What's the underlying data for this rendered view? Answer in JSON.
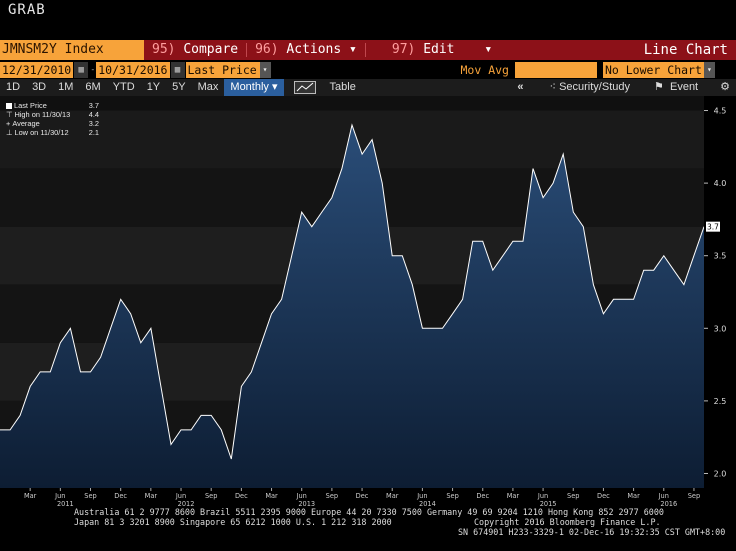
{
  "app_title": "GRAB",
  "toolbar": {
    "ticker": "JMNSM2Y Index",
    "compare_num": "95)",
    "compare_label": "Compare",
    "actions_num": "96)",
    "actions_label": "Actions",
    "edit_num": "97)",
    "edit_label": "Edit",
    "view_title": "Line Chart"
  },
  "date_range": {
    "start": "12/31/2010",
    "end": "10/31/2016",
    "field": "Last Price",
    "study": "Mov Avg",
    "lower_chart": "No Lower Chart"
  },
  "periods": [
    "1D",
    "3D",
    "1M",
    "6M",
    "YTD",
    "1Y",
    "5Y",
    "Max"
  ],
  "frequency": "Monthly",
  "table_label": "Table",
  "security_study_label": "Security/Study",
  "event_label": "Event",
  "legend": {
    "last_label": "Last Price",
    "last_value": "3.7",
    "high_label": "High on 11/30/13",
    "high_value": "4.4",
    "avg_label": "Average",
    "avg_value": "3.2",
    "low_label": "Low on 11/30/12",
    "low_value": "2.1"
  },
  "colors": {
    "background": "#000000",
    "line": "#ffffff",
    "fill": "#1d3a5e",
    "toolbar": "#8c1118",
    "accent": "#f7a33a"
  },
  "chart_data": {
    "type": "area",
    "series": [
      {
        "name": "Last Price",
        "values": [
          2.3,
          2.3,
          2.4,
          2.6,
          2.7,
          2.7,
          2.9,
          3.0,
          2.7,
          2.7,
          2.8,
          3.0,
          3.2,
          3.1,
          2.9,
          3.0,
          2.6,
          2.2,
          2.3,
          2.3,
          2.4,
          2.4,
          2.3,
          2.1,
          2.6,
          2.7,
          2.9,
          3.1,
          3.2,
          3.5,
          3.8,
          3.7,
          3.8,
          3.9,
          4.1,
          4.4,
          4.2,
          4.3,
          4.0,
          3.5,
          3.5,
          3.3,
          3.0,
          3.0,
          3.0,
          3.1,
          3.2,
          3.6,
          3.6,
          3.4,
          3.5,
          3.6,
          3.6,
          4.1,
          3.9,
          4.0,
          4.2,
          3.8,
          3.7,
          3.3,
          3.1,
          3.2,
          3.2,
          3.2,
          3.4,
          3.4,
          3.5,
          3.4,
          3.3,
          3.5,
          3.7
        ]
      }
    ],
    "x_start": "2010-12",
    "x_end": "2016-10",
    "x_tick_labels": [
      "Mar",
      "Jun",
      "Sep",
      "Dec",
      "Mar",
      "Jun",
      "Sep",
      "Dec",
      "Mar",
      "Jun",
      "Sep",
      "Dec",
      "Mar",
      "Jun",
      "Sep",
      "Dec",
      "Mar",
      "Jun",
      "Sep",
      "Dec",
      "Mar",
      "Jun",
      "Sep"
    ],
    "year_labels": [
      "2011",
      "2012",
      "2013",
      "2014",
      "2015",
      "2016"
    ],
    "y_ticks": [
      "2.0",
      "2.5",
      "3.0",
      "3.5",
      "4.0",
      "4.5"
    ],
    "ylim": [
      1.9,
      4.6
    ],
    "last_value_label": "3.7",
    "grid": "horizontal bands"
  },
  "footer": {
    "line1": "Australia 61 2 9777 8600 Brazil 5511 2395 9000 Europe 44 20 7330 7500 Germany 49 69 9204 1210 Hong Kong 852 2977 6000",
    "line2a": "Japan 81 3 3201 8900         Singapore 65 6212 1000         U.S. 1 212 318 2000",
    "line2b": "Copyright 2016 Bloomberg Finance L.P.",
    "line3": "SN 674901 H233-3329-1 02-Dec-16 19:32:35 CST  GMT+8:00"
  }
}
